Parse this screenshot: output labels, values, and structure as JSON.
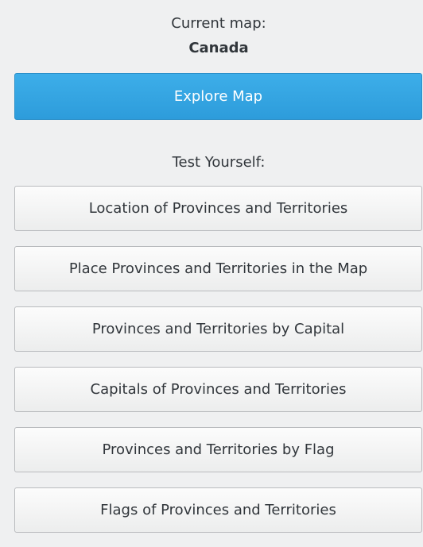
{
  "current_map": {
    "label": "Current map:",
    "name": "Canada"
  },
  "explore": {
    "label": "Explore Map"
  },
  "test": {
    "label": "Test Yourself:",
    "buttons": [
      "Location of Provinces and Territories",
      "Place Provinces and Territories in the Map",
      "Provinces and Territories by Capital",
      "Capitals of Provinces and Territories",
      "Provinces and Territories by Flag",
      "Flags of Provinces and Territories"
    ]
  },
  "colors": {
    "accent": "#3daee9",
    "background": "#eff0f1"
  }
}
